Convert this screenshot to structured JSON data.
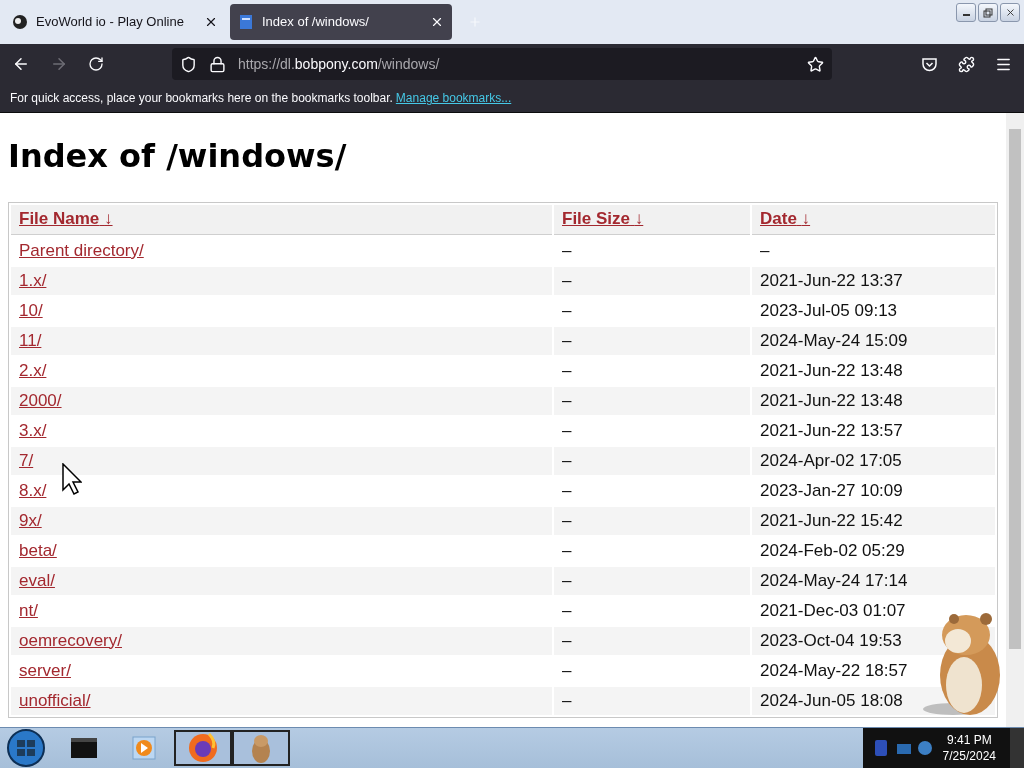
{
  "browser": {
    "tabs": [
      {
        "title": "EvoWorld io - Play Online",
        "selected": false
      },
      {
        "title": "Index of /windows/",
        "selected": true
      }
    ],
    "address": {
      "prefix": "https://dl.",
      "domain": "bobpony.com",
      "path": "/windows/"
    },
    "bookmarks_bar": {
      "message": "For quick access, place your bookmarks here on the bookmarks toolbar.",
      "link": "Manage bookmarks..."
    }
  },
  "page": {
    "heading": "Index of /windows/",
    "columns": [
      {
        "label": "File Name",
        "sort_mark": "↓"
      },
      {
        "label": "File Size",
        "sort_mark": "↓"
      },
      {
        "label": "Date",
        "sort_mark": "↓"
      }
    ],
    "rows": [
      {
        "name": "Parent directory/",
        "size": "–",
        "date": "–"
      },
      {
        "name": "1.x/",
        "size": "–",
        "date": "2021-Jun-22 13:37"
      },
      {
        "name": "10/",
        "size": "–",
        "date": "2023-Jul-05 09:13"
      },
      {
        "name": "11/",
        "size": "–",
        "date": "2024-May-24 15:09"
      },
      {
        "name": "2.x/",
        "size": "–",
        "date": "2021-Jun-22 13:48"
      },
      {
        "name": "2000/",
        "size": "–",
        "date": "2021-Jun-22 13:48"
      },
      {
        "name": "3.x/",
        "size": "–",
        "date": "2021-Jun-22 13:57"
      },
      {
        "name": "7/",
        "size": "–",
        "date": "2024-Apr-02 17:05"
      },
      {
        "name": "8.x/",
        "size": "–",
        "date": "2023-Jan-27 10:09"
      },
      {
        "name": "9x/",
        "size": "–",
        "date": "2021-Jun-22 15:42"
      },
      {
        "name": "beta/",
        "size": "–",
        "date": "2024-Feb-02 05:29"
      },
      {
        "name": "eval/",
        "size": "–",
        "date": "2024-May-24 17:14"
      },
      {
        "name": "nt/",
        "size": "–",
        "date": "2021-Dec-03 01:07"
      },
      {
        "name": "oemrecovery/",
        "size": "–",
        "date": "2023-Oct-04 19:53"
      },
      {
        "name": "server/",
        "size": "–",
        "date": "2024-May-22 18:57"
      },
      {
        "name": "unofficial/",
        "size": "–",
        "date": "2024-Jun-05 18:08"
      }
    ]
  },
  "taskbar": {
    "time": "9:41 PM",
    "date": "7/25/2024"
  }
}
